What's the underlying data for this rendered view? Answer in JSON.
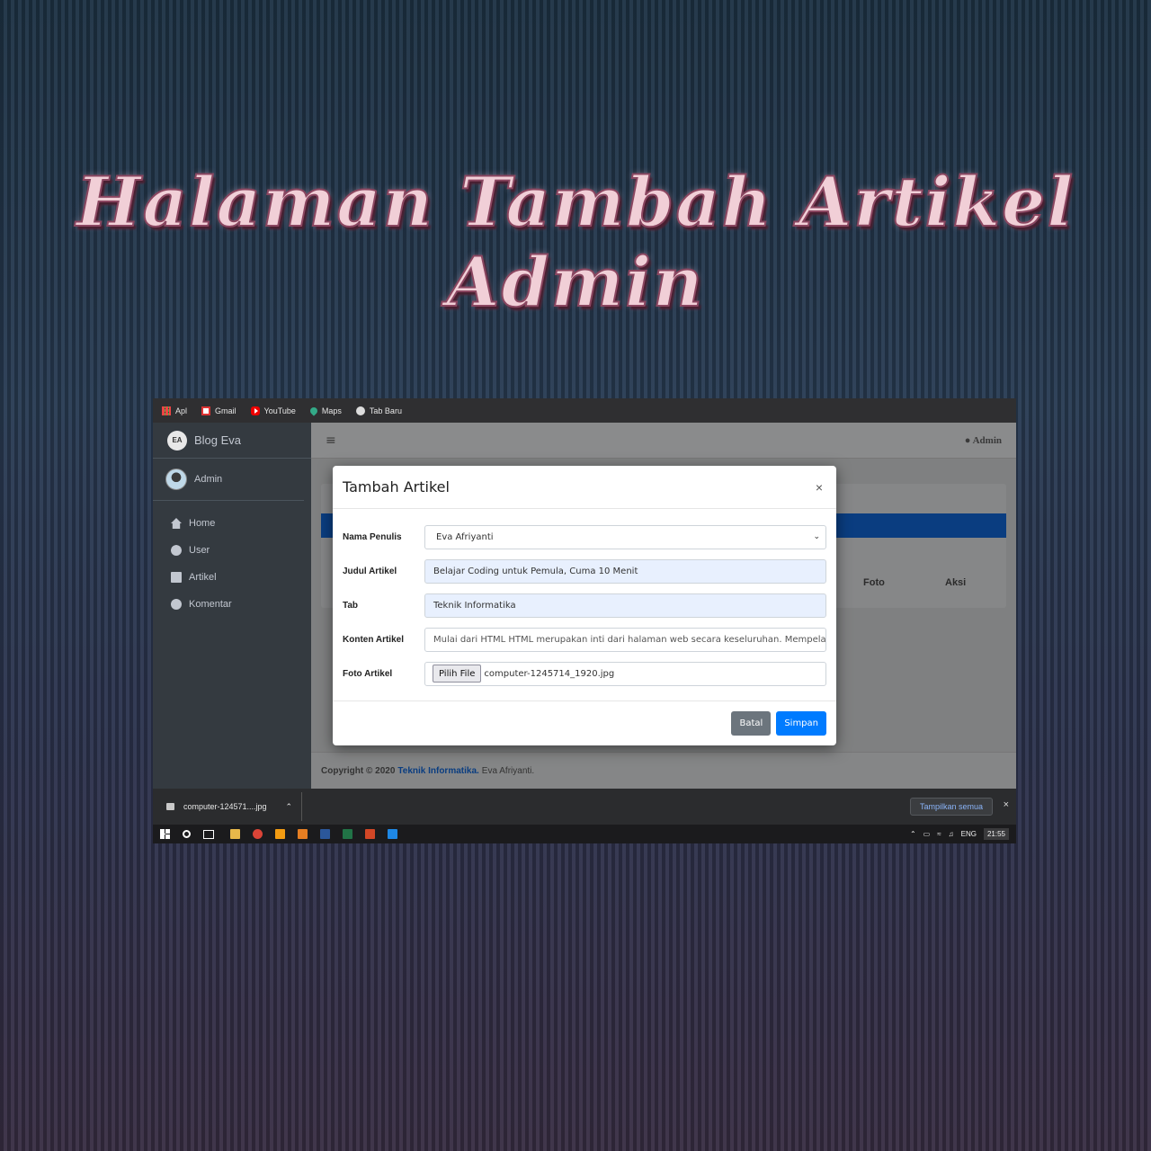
{
  "hero": {
    "title": "Halaman Tambah Artikel Admin"
  },
  "browser": {
    "bookmarks": [
      {
        "label": "Apl",
        "icon": "apps-icon"
      },
      {
        "label": "Gmail",
        "icon": "gmail-icon"
      },
      {
        "label": "YouTube",
        "icon": "youtube-icon"
      },
      {
        "label": "Maps",
        "icon": "maps-icon"
      },
      {
        "label": "Tab Baru",
        "icon": "globe-icon"
      }
    ]
  },
  "sidebar": {
    "brand": "Blog Eva",
    "brand_logo": "EA",
    "user": "Admin",
    "items": [
      {
        "label": "Home",
        "icon": "home-icon"
      },
      {
        "label": "User",
        "icon": "user-icon"
      },
      {
        "label": "Artikel",
        "icon": "book-icon"
      },
      {
        "label": "Komentar",
        "icon": "comment-icon"
      }
    ]
  },
  "topbar": {
    "menu_icon": "≡",
    "admin_label": "Admin"
  },
  "table": {
    "headers": [
      "Foto",
      "Aksi"
    ]
  },
  "footer": {
    "copyright": "Copyright © 2020",
    "link": "Teknik Informatika.",
    "author": "Eva Afriyanti."
  },
  "modal": {
    "title": "Tambah Artikel",
    "close": "×",
    "fields": {
      "nama_penulis": {
        "label": "Nama Penulis",
        "value": "Eva Afriyanti"
      },
      "judul_artikel": {
        "label": "Judul Artikel",
        "value": "Belajar Coding untuk Pemula, Cuma 10 Menit"
      },
      "tab": {
        "label": "Tab",
        "value": "Teknik Informatika"
      },
      "konten_artikel": {
        "label": "Konten Artikel",
        "value": "Mulai dari HTML HTML merupakan inti dari halaman web secara keseluruhan. Mempelajari HTML"
      },
      "foto_artikel": {
        "label": "Foto Artikel",
        "button": "Pilih File",
        "filename": "computer-1245714_1920.jpg"
      }
    },
    "buttons": {
      "cancel": "Batal",
      "save": "Simpan"
    }
  },
  "download_bar": {
    "file": "computer-124571....jpg",
    "show_all": "Tampilkan semua",
    "close": "×"
  },
  "taskbar": {
    "language": "ENG",
    "time": "21:55"
  },
  "colors": {
    "primary": "#007bff",
    "secondary": "#6c757d",
    "sidebar": "#343a40"
  }
}
